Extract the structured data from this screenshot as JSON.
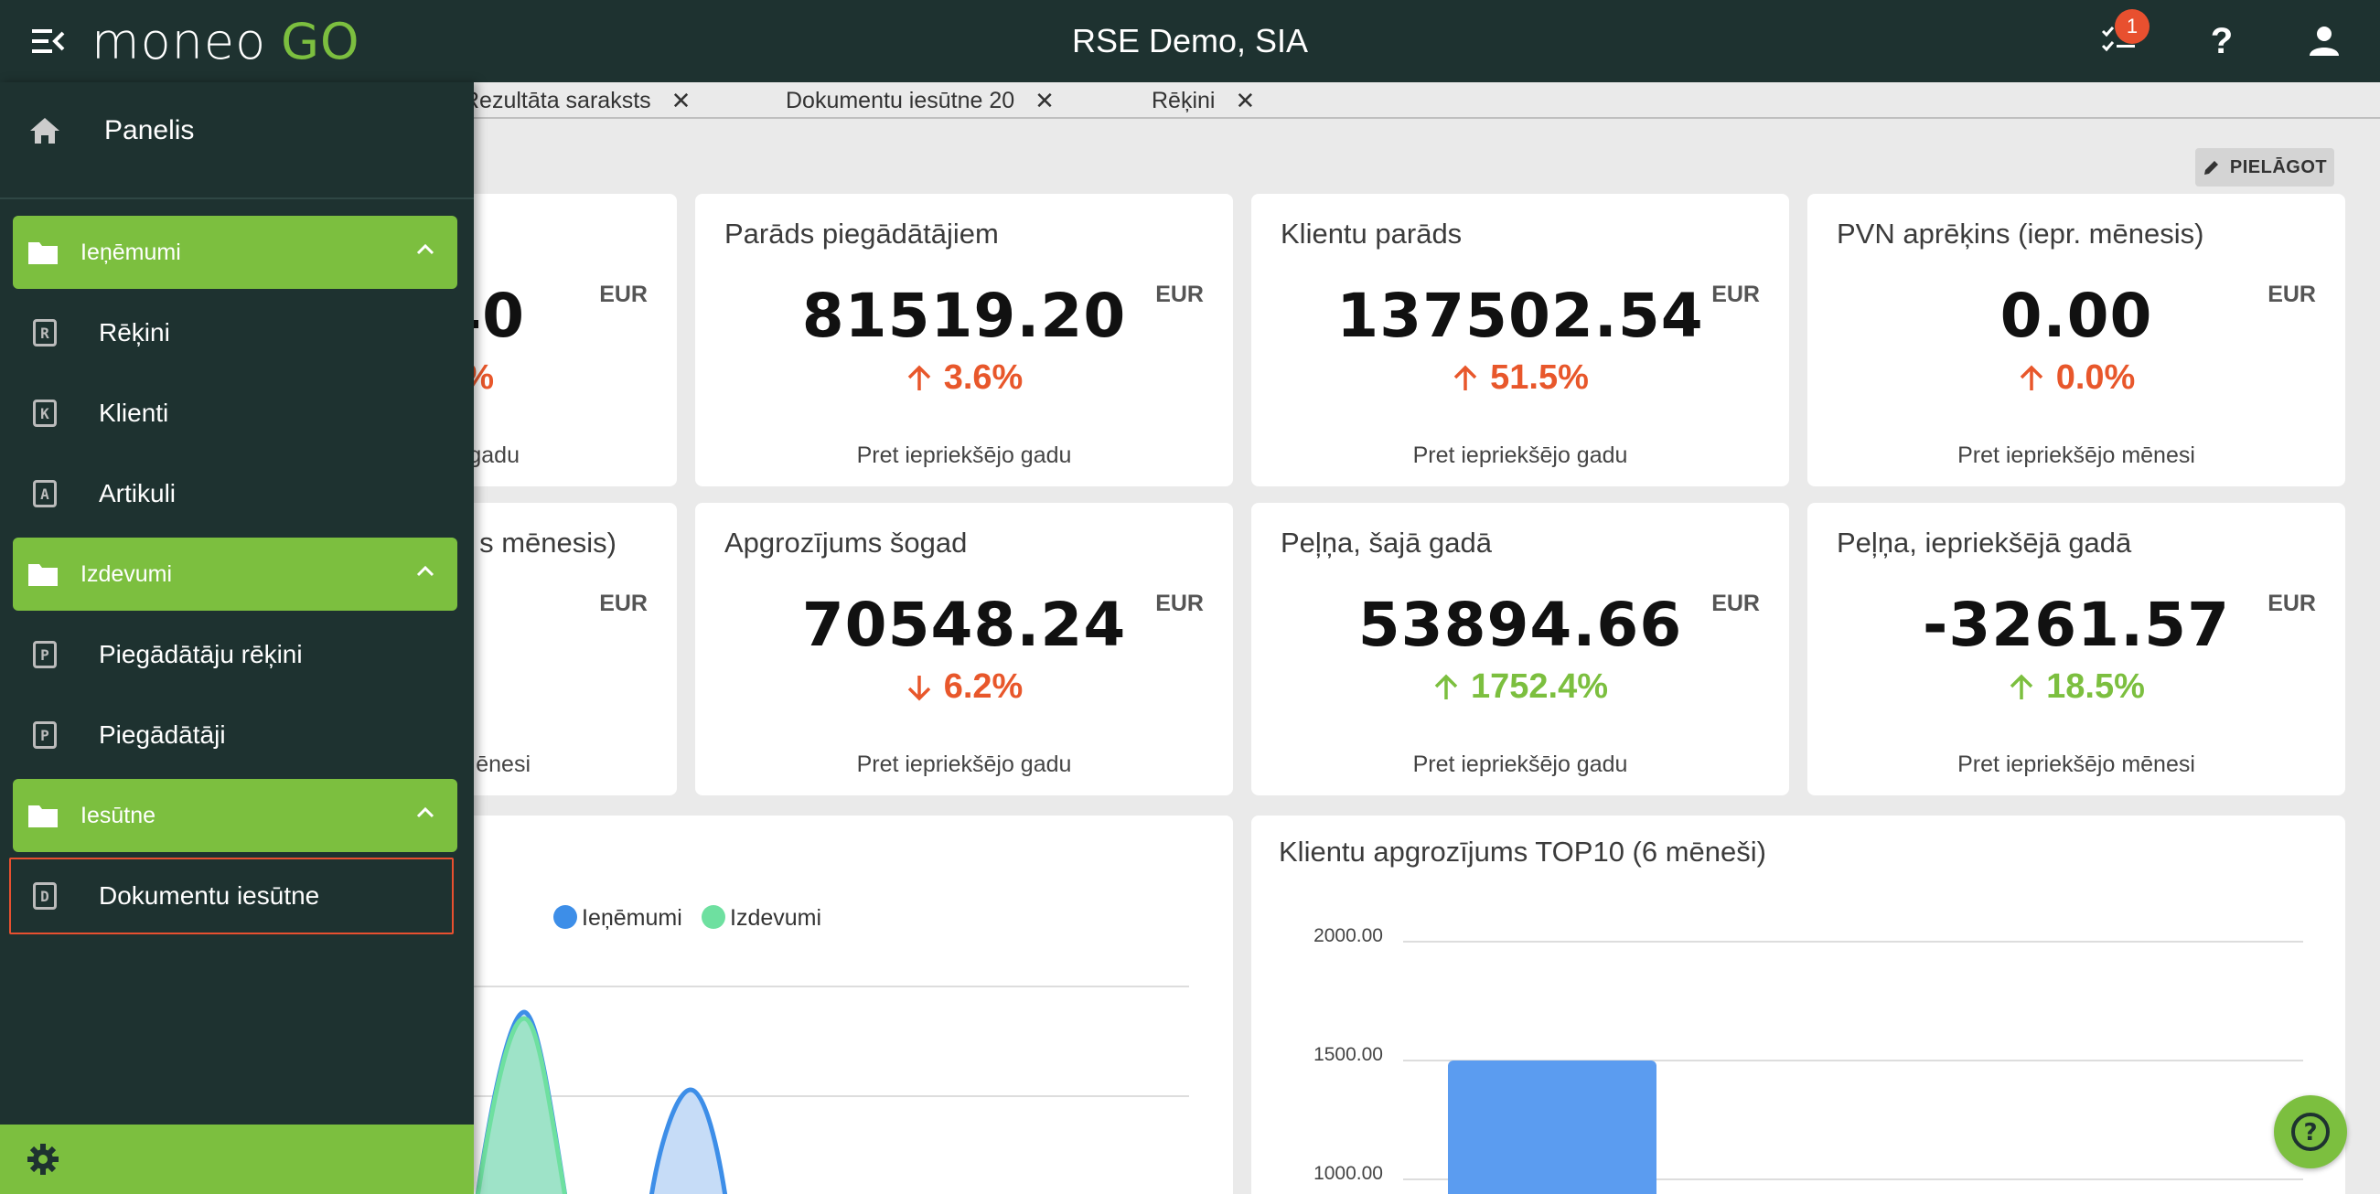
{
  "header": {
    "logo_main": "moneo",
    "logo_accent": "GO",
    "company": "RSE Demo, SIA",
    "notification_count": "1",
    "help_glyph": "?",
    "icons": [
      "menu-collapse-icon",
      "tasks-icon",
      "help-icon",
      "user-icon"
    ]
  },
  "tabs": [
    {
      "label": "Rezultāta saraksts",
      "close": "✕"
    },
    {
      "label": "Dokumentu iesūtne 20",
      "close": "✕"
    },
    {
      "label": "Rēķini",
      "close": "✕"
    }
  ],
  "toolbar": {
    "adjust_label": "PIELĀGOT"
  },
  "cards_row1": [
    {
      "title": "",
      "currency": "EUR",
      "value": "40",
      "change": "%",
      "direction": "up",
      "note": "gadu",
      "color": "#e8572b"
    },
    {
      "title": "Parāds piegādātājiem",
      "currency": "EUR",
      "value": "81519.20",
      "change": "3.6%",
      "direction": "up",
      "note": "Pret iepriekšējo gadu",
      "color": "#e8572b"
    },
    {
      "title": "Klientu parāds",
      "currency": "EUR",
      "value": "137502.54",
      "change": "51.5%",
      "direction": "up",
      "note": "Pret iepriekšējo gadu",
      "color": "#e8572b"
    },
    {
      "title": "PVN aprēķins (iepr. mēnesis)",
      "currency": "EUR",
      "value": "0.00",
      "change": "0.0%",
      "direction": "up",
      "note": "Pret iepriekšējo mēnesi",
      "color": "#e8572b"
    }
  ],
  "cards_row2": [
    {
      "title": "s mēnesis)",
      "currency": "EUR",
      "value": "",
      "change": "",
      "direction": "",
      "note": "ēnesi",
      "color": "#e8572b"
    },
    {
      "title": "Apgrozījums šogad",
      "currency": "EUR",
      "value": "70548.24",
      "change": "6.2%",
      "direction": "down",
      "note": "Pret iepriekšējo gadu",
      "color": "#e8572b"
    },
    {
      "title": "Peļņa, šajā gadā",
      "currency": "EUR",
      "value": "53894.66",
      "change": "1752.4%",
      "direction": "up",
      "note": "Pret iepriekšējo gadu",
      "color": "#7cbf3f"
    },
    {
      "title": "Peļņa, iepriekšējā gadā",
      "currency": "EUR",
      "value": "-3261.57",
      "change": "18.5%",
      "direction": "up",
      "note": "Pret iepriekšējo mēnesi",
      "color": "#7cbf3f"
    }
  ],
  "chart_data": [
    {
      "type": "area",
      "title": "",
      "legend": [
        "Ieņēmumi",
        "Izdevumi"
      ],
      "legend_position": "top",
      "series": [
        {
          "name": "Ieņēmumi",
          "color": "#3d8ee8"
        },
        {
          "name": "Izdevumi",
          "color": "#6ee0a0"
        }
      ],
      "grid": true
    },
    {
      "type": "bar",
      "title": "Klientu apgrozījums TOP10 (6 mēneši)",
      "y_ticks": [
        "2000.00",
        "1500.00",
        "1000.00"
      ],
      "values": [
        1500
      ],
      "ylim": [
        1000,
        2000
      ],
      "bar_color": "#5b9cf0",
      "grid": true
    }
  ],
  "sidebar": {
    "home": {
      "label": "Panelis",
      "icon": "home-icon"
    },
    "groups": [
      {
        "label": "Ieņēmumi",
        "items": [
          {
            "letter": "R",
            "label": "Rēķini"
          },
          {
            "letter": "K",
            "label": "Klienti"
          },
          {
            "letter": "A",
            "label": "Artikuli"
          }
        ]
      },
      {
        "label": "Izdevumi",
        "items": [
          {
            "letter": "P",
            "label": "Piegādātāju rēķini"
          },
          {
            "letter": "P",
            "label": "Piegādātāji"
          }
        ]
      },
      {
        "label": "Iesūtne",
        "items": [
          {
            "letter": "D",
            "label": "Dokumentu iesūtne"
          }
        ]
      }
    ],
    "footer_icon": "gear-icon"
  },
  "colors": {
    "topbar": "#1e3230",
    "accent_green": "#7cbf3f",
    "accent_red": "#e8572b"
  }
}
